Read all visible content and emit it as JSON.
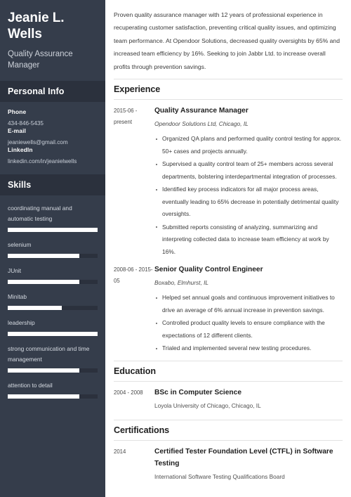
{
  "sidebar": {
    "name": "Jeanie L. Wells",
    "job_title": "Quality Assurance Manager",
    "personal_info": {
      "heading": "Personal Info",
      "fields": [
        {
          "label": "Phone",
          "value": "434-846-5435"
        },
        {
          "label": "E-mail",
          "value": "jeaniewells@gmail.com"
        },
        {
          "label": "LinkedIn",
          "value": "linkedin.com/in/jeanielwells"
        }
      ]
    },
    "skills": {
      "heading": "Skills",
      "items": [
        {
          "name": "coordinating manual and automatic testing",
          "level": 100
        },
        {
          "name": "selenium",
          "level": 80
        },
        {
          "name": "JUnit",
          "level": 80
        },
        {
          "name": "Minitab",
          "level": 60
        },
        {
          "name": "leadership",
          "level": 100
        },
        {
          "name": "strong communication and time management",
          "level": 80
        },
        {
          "name": "attention to detail",
          "level": 80
        }
      ]
    },
    "colors": {
      "background": "#353d4b",
      "header_band": "#2b313d",
      "bar_fill": "#ffffff"
    }
  },
  "main": {
    "summary": "Proven quality assurance manager with 12 years of professional experience in recuperating customer satisfaction, preventing critical quality issues, and optimizing team performance. At Opendoor Solutions, decreased quality oversights by 65% and increased team efficiency by 16%. Seeking to join Jabbr Ltd. to increase overall profits through prevention savings.",
    "experience": {
      "heading": "Experience",
      "entries": [
        {
          "dates": "2015-06 - present",
          "title": "Quality Assurance Manager",
          "subtitle": "Opendoor Solutions Ltd, Chicago, IL",
          "bullets": [
            "Organized QA plans and performed quality control testing for approx. 50+ cases and projects annually.",
            "Supervised a quality control team of 25+ members across several departments, bolstering interdepartmental integration of processes.",
            "Identified key process indicators for all major process areas, eventually leading to 65% decrease in potentially detrimental quality oversights.",
            "Submitted reports consisting of analyzing, summarizing and interpreting collected data to increase team efficiency at work by 16%."
          ]
        },
        {
          "dates": "2008-06 - 2015-05",
          "title": "Senior Quality Control Engineer",
          "subtitle": "Boxabo, Elmhurst, IL",
          "bullets": [
            "Helped set annual goals and continuous improvement initiatives to drive an average of 6% annual increase in prevention savings.",
            "Controlled product quality levels to ensure compliance with the expectations of 12 different clients.",
            "Trialed and implemented several new testing procedures."
          ]
        }
      ]
    },
    "education": {
      "heading": "Education",
      "entries": [
        {
          "dates": "2004 - 2008",
          "title": "BSc in Computer Science",
          "subtitle": "Loyola University of Chicago, Chicago, IL"
        }
      ]
    },
    "certifications": {
      "heading": "Certifications",
      "entries": [
        {
          "dates": "2014",
          "title": "Certified Tester Foundation Level (CTFL) in Software Testing",
          "subtitle": "International Software Testing Qualifications Board"
        }
      ]
    }
  }
}
